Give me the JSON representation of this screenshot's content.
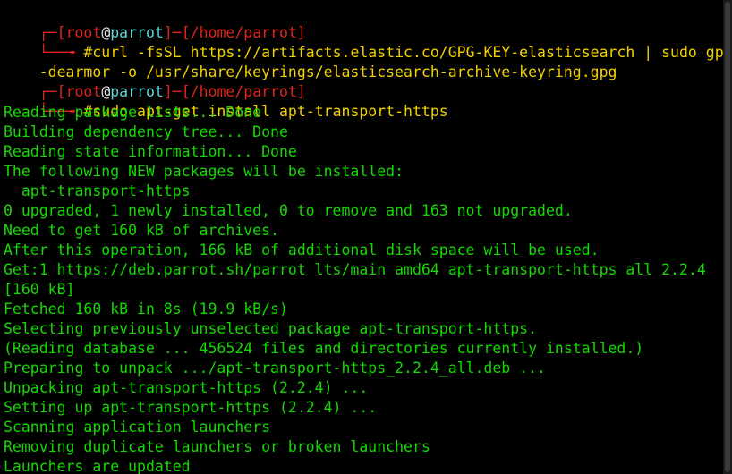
{
  "colors": {
    "background": "#000000",
    "prompt_bracket": "#e0241b",
    "hostname": "#5fd7d7",
    "command": "#f0d000",
    "output": "#14d900"
  },
  "prompt1": {
    "box_top": "┌─",
    "open_bracket": "[",
    "user": "root",
    "at": "@",
    "host": "parrot",
    "close_dash": "]─[",
    "path": "/home/parrot",
    "close_bracket": "]",
    "box_bottom": "└──╼ ",
    "hash": "#",
    "command_line1": "curl -fsSL https://artifacts.elastic.co/GPG-KEY-elasticsearch | sudo gpg -",
    "command_line2": "-dearmor -o /usr/share/keyrings/elasticsearch-archive-keyring.gpg"
  },
  "prompt2": {
    "box_top": "┌─",
    "open_bracket": "[",
    "user": "root",
    "at": "@",
    "host": "parrot",
    "close_dash": "]─[",
    "path": "/home/parrot",
    "close_bracket": "]",
    "box_bottom": "└──╼ ",
    "hash": "#",
    "command": "sudo apt-get install apt-transport-https"
  },
  "output_lines": [
    "Reading package lists... Done",
    "Building dependency tree... Done",
    "Reading state information... Done",
    "The following NEW packages will be installed:",
    "  apt-transport-https",
    "0 upgraded, 1 newly installed, 0 to remove and 163 not upgraded.",
    "Need to get 160 kB of archives.",
    "After this operation, 166 kB of additional disk space will be used.",
    "Get:1 https://deb.parrot.sh/parrot lts/main amd64 apt-transport-https all 2.2.4",
    "[160 kB]",
    "Fetched 160 kB in 8s (19.9 kB/s)",
    "Selecting previously unselected package apt-transport-https.",
    "(Reading database ... 456524 files and directories currently installed.)",
    "Preparing to unpack .../apt-transport-https_2.2.4_all.deb ...",
    "Unpacking apt-transport-https (2.2.4) ...",
    "Setting up apt-transport-https (2.2.4) ...",
    "Scanning application launchers",
    "Removing duplicate launchers or broken launchers",
    "Launchers are updated"
  ]
}
